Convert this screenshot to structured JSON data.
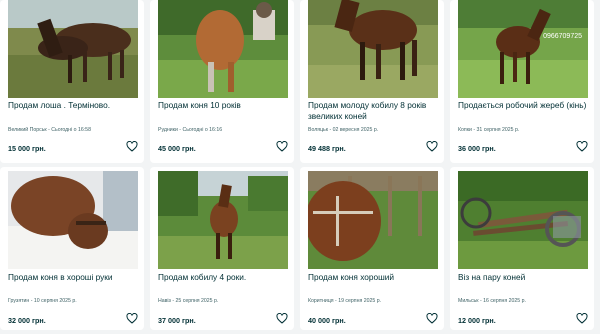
{
  "listings": [
    {
      "title": "Продам лоша . Терміново.",
      "location_date": "Великий Порськ - Сьогодні о 16:58",
      "price": "15 000 грн.",
      "photo": "foal-brown-two-horses"
    },
    {
      "title": "Продам коня 10 років",
      "location_date": "Рудники - Сьогодні о 16:16",
      "price": "45 000 грн.",
      "photo": "chestnut-horse-rider"
    },
    {
      "title": "Продам молоду кобилу 8 років звеликих коней",
      "location_date": "Воляцьк - 02 вересня 2025 р.",
      "price": "49 488 грн.",
      "photo": "bay-horse-field"
    },
    {
      "title": "Продається робочий жереб (кінь)",
      "location_date": "Копки - 31 серпня 2025 р.",
      "price": "36 000 грн.",
      "photo": "bay-colt-pasture",
      "overlay_text": "0966709725"
    },
    {
      "title": "Продам коня в хороші руки",
      "location_date": "Грузятин - 10 серпня 2025 р.",
      "price": "32 000 грн.",
      "photo": "horse-head-snow"
    },
    {
      "title": "Продам кобилу 4 роки.",
      "location_date": "Навіз - 25 серпня 2025 р.",
      "price": "37 000 грн.",
      "photo": "bay-mare-yard"
    },
    {
      "title": "Продам коня хороший",
      "location_date": "Коритниця - 19 серпня 2025 р.",
      "price": "40 000 грн.",
      "photo": "horse-harness-fence"
    },
    {
      "title": "Віз на пару коней",
      "location_date": "Мильськ - 16 серпня 2025 р.",
      "price": "12 000 грн.",
      "photo": "wooden-cart-grass"
    }
  ],
  "favorite_icon": "heart-outline-icon",
  "colors": {
    "text": "#002f34",
    "meta": "#406367",
    "card": "#ffffff",
    "page": "#f2f4f5"
  }
}
